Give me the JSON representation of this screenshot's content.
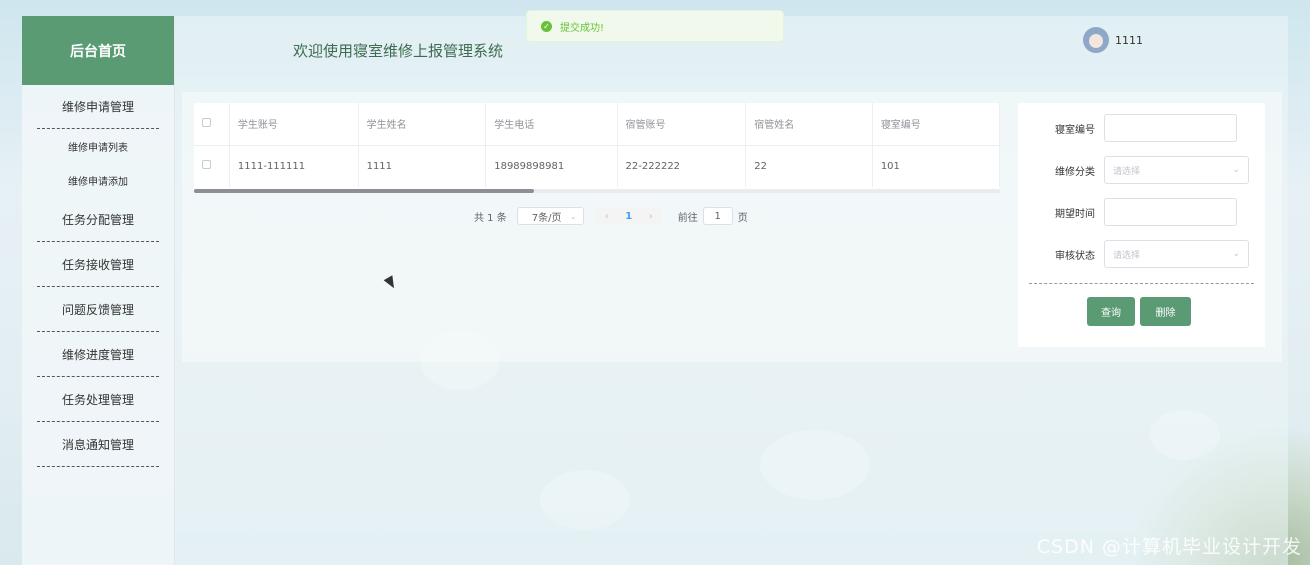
{
  "sidebar": {
    "home": "后台首页",
    "groups": [
      {
        "title": "维修申请管理",
        "items": [
          "维修申请列表",
          "维修申请添加"
        ]
      },
      {
        "title": "任务分配管理"
      },
      {
        "title": "任务接收管理"
      },
      {
        "title": "问题反馈管理"
      },
      {
        "title": "维修进度管理"
      },
      {
        "title": "任务处理管理"
      },
      {
        "title": "消息通知管理"
      }
    ]
  },
  "header": {
    "title": "欢迎使用寝室维修上报管理系统",
    "username": "1111"
  },
  "toast": {
    "message": "提交成功!",
    "icon": "check-icon"
  },
  "table": {
    "columns": [
      "学生账号",
      "学生姓名",
      "学生电话",
      "宿管账号",
      "宿管姓名",
      "寝室编号"
    ],
    "rows": [
      [
        "1111-111111",
        "1111",
        "18989898981",
        "22-222222",
        "22",
        "101"
      ]
    ]
  },
  "pagination": {
    "total": "共 1 条",
    "page_size": "7条/页",
    "current_page": "1",
    "goto_label": "前往",
    "goto_value": "1",
    "page_suffix": "页"
  },
  "search": {
    "dorm_no_label": "寝室编号",
    "category_label": "维修分类",
    "category_placeholder": "请选择",
    "expected_time_label": "期望时间",
    "status_label": "审核状态",
    "status_placeholder": "请选择",
    "query_button": "查询",
    "delete_button": "删除"
  },
  "watermark": "CSDN @计算机毕业设计开发",
  "colors": {
    "accent": "#5a9b74",
    "success": "#67c23a",
    "link": "#409eff"
  }
}
